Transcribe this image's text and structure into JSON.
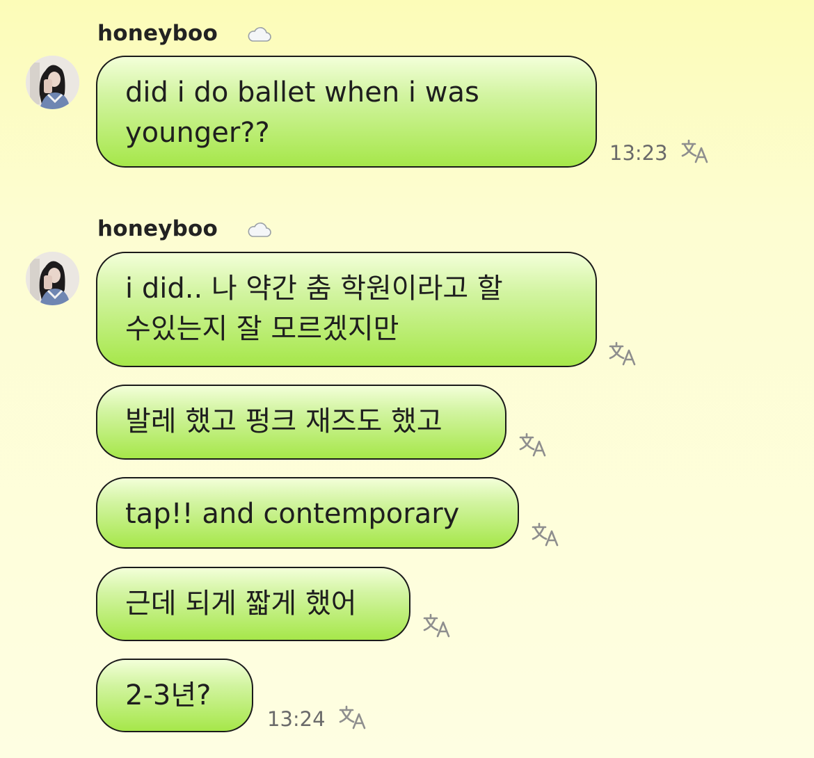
{
  "messages": [
    {
      "sender": "honeybooㅤ",
      "text_lines": [
        "did i do ballet when i was",
        "younger??"
      ],
      "time": "13:23"
    },
    {
      "sender": "honeybooㅤ",
      "bubbles": [
        {
          "text_lines": [
            "i did.. 나 약간 춤 학원이라고 할",
            "수있는지 잘 모르겠지만"
          ]
        },
        {
          "text_lines": [
            "발레 했고 펑크 재즈도 했고"
          ]
        },
        {
          "text_lines": [
            "tap!! and contemporary"
          ]
        },
        {
          "text_lines": [
            "근데 되게 짧게 했어"
          ]
        },
        {
          "text_lines": [
            "2-3년?"
          ]
        }
      ],
      "time": "13:24"
    }
  ],
  "icons": {
    "translate": "translate-icon",
    "cloud": "cloud-icon"
  },
  "colors": {
    "bubble_top": "#f3ffd9",
    "bubble_bottom": "#a6e74a",
    "bubble_border": "#1a1a1a",
    "background": "#fcfcb8"
  }
}
